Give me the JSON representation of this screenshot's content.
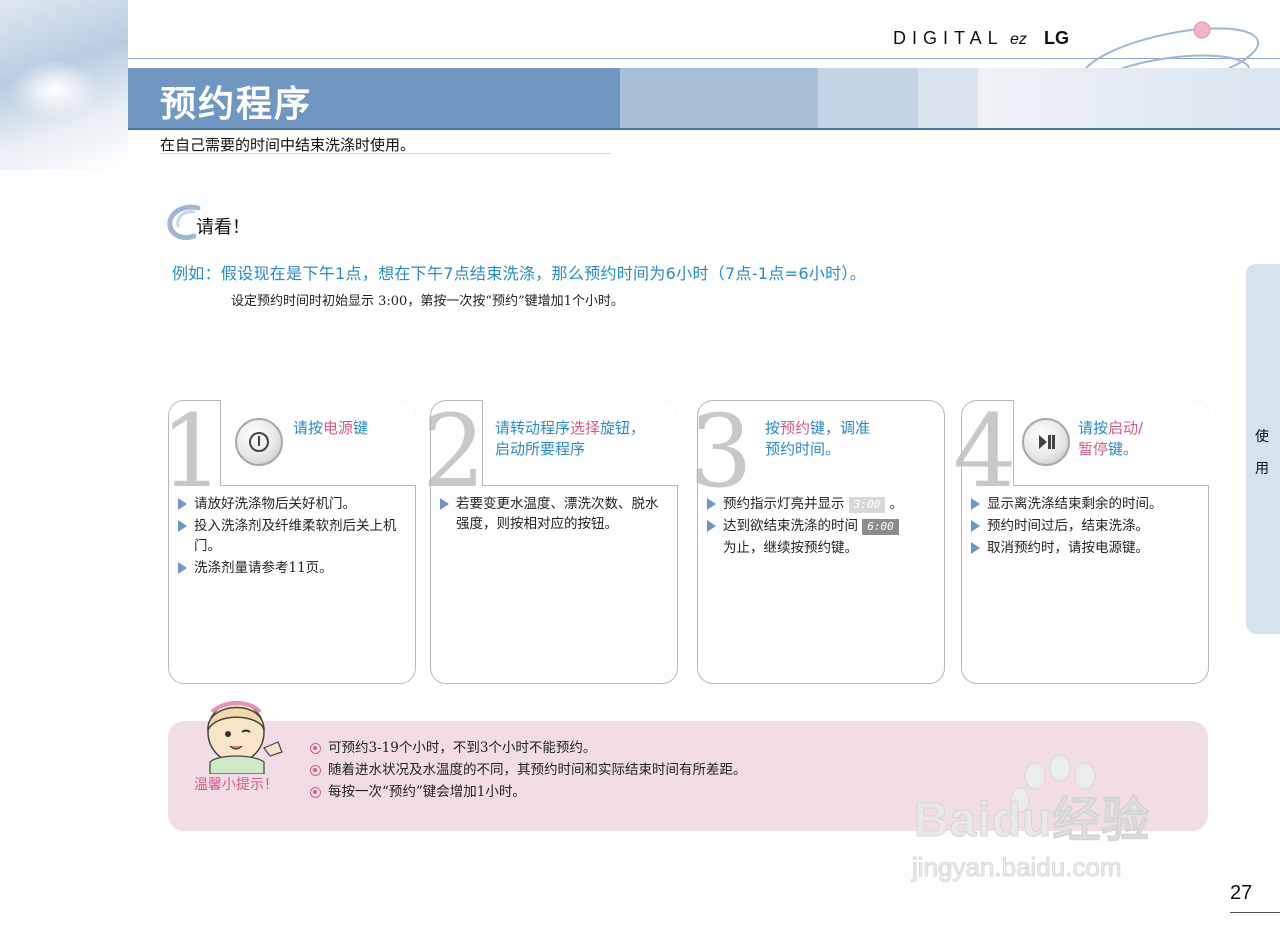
{
  "header": {
    "brand_digital": "DIGITAL",
    "brand_ez": "ez",
    "brand_lg": "LG",
    "title": "预约程序",
    "subtitle": "在自己需要的时间中结束洗涤时使用。"
  },
  "notice": {
    "title": "请看！",
    "example": "例如：假设现在是下午1点，想在下午7点结束洗涤，那么预约时间为6小时（7点-1点=6小时）。",
    "example_sub": "设定预约时间时初始显示  3:00，第按一次按“预约”键增加1个小时。"
  },
  "side_tab": {
    "char1": "使",
    "char2": "用"
  },
  "steps": [
    {
      "number": "1",
      "head_pre": "请按",
      "head_hl": "电源",
      "head_post": "键",
      "items": [
        "请放好洗涤物后关好机门。",
        "投入洗涤剂及纤维柔软剂后关上机门。",
        "洗涤剂量请参考11页。"
      ]
    },
    {
      "number": "2",
      "head_line1_pre": "请转动程序",
      "head_line1_hl": "选择",
      "head_line1_post": "旋钮，",
      "head_line2": "启动所要程序",
      "items": [
        "若要变更水温度、漂洗次数、脱水强度，则按相对应的按钮。"
      ]
    },
    {
      "number": "3",
      "head_line1_pre": "按",
      "head_line1_hl": "预约",
      "head_line1_post": "键，调准",
      "head_line2": "预约时间。",
      "item1_pre": "预约指示灯亮并显示",
      "lcd1": "3:00",
      "item1_post": "。",
      "item2_pre": "达到欲结束洗涤的时间",
      "lcd2": "6:00",
      "item2_cont": "为止，继续按预约键。"
    },
    {
      "number": "4",
      "head_line1_pre": "请按",
      "head_line1_hl": "启动/",
      "head_line2_hl": "暂停",
      "head_line2_post": "键。",
      "items": [
        "显示离洗涤结束剩余的时间。",
        "预约时间过后，结束洗涤。",
        "取消预约时，请按电源键。"
      ]
    }
  ],
  "tips": {
    "label": "温馨小提示！",
    "items": [
      "可预约3-19个小时，不到3个小时不能预约。",
      "随着进水状况及水温度的不同，其预约时间和实际结束时间有所差距。",
      "每按一次“预约”键会增加1小时。"
    ]
  },
  "watermark": {
    "text": "Baidu经验",
    "url": "jingyan.baidu.com"
  },
  "page_number": "27",
  "colors": {
    "accent_blue": "#2a8ac4",
    "highlight_pink": "#d55b8a",
    "band_blue": "#6f97c1",
    "tips_bg": "#f2dde6"
  }
}
